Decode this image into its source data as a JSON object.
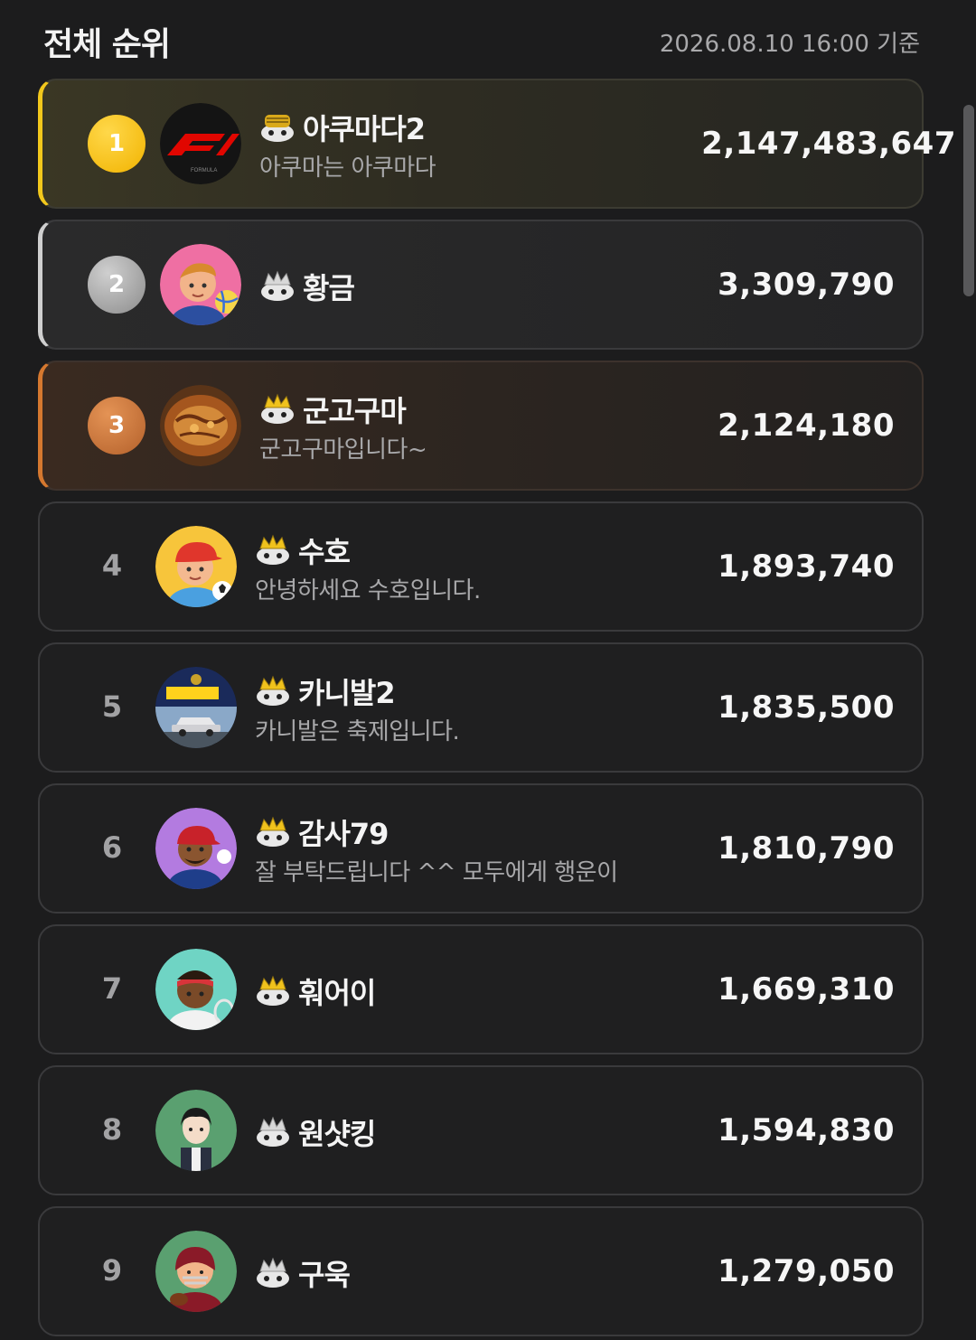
{
  "header": {
    "title": "전체 순위",
    "timestamp": "2026.08.10 16:00 기준"
  },
  "ranking": [
    {
      "rank": "1",
      "name": "아쿠마다2",
      "bio": "아쿠마는 아쿠마다",
      "score": "2,147,483,647",
      "avatar": "f1-logo-avatar",
      "level": "gold-level-icon"
    },
    {
      "rank": "2",
      "name": "황금",
      "bio": "",
      "score": "3,309,790",
      "avatar": "volleyball-boy-avatar",
      "level": "silver-level-icon"
    },
    {
      "rank": "3",
      "name": "군고구마",
      "bio": "군고구마입니다~",
      "score": "2,124,180",
      "avatar": "roasted-sweet-potato-avatar",
      "level": "gold-level-icon"
    },
    {
      "rank": "4",
      "name": "수호",
      "bio": "안녕하세요 수호입니다.",
      "score": "1,893,740",
      "avatar": "soccer-boy-avatar",
      "level": "gold-level-icon"
    },
    {
      "rank": "5",
      "name": "카니발2",
      "bio": "카니발은 축제입니다.",
      "score": "1,835,500",
      "avatar": "carnival-car-avatar",
      "level": "gold-level-icon"
    },
    {
      "rank": "6",
      "name": "감사79",
      "bio": "잘 부탁드립니다 ^^ 모두에게 행운이",
      "score": "1,810,790",
      "avatar": "baseball-man-avatar",
      "level": "gold-level-icon"
    },
    {
      "rank": "7",
      "name": "훠어이",
      "bio": "",
      "score": "1,669,310",
      "avatar": "tennis-player-avatar",
      "level": "gold-level-icon"
    },
    {
      "rank": "8",
      "name": "원샷킹",
      "bio": "",
      "score": "1,594,830",
      "avatar": "cartoon-man-avatar",
      "level": "silver-level-icon"
    },
    {
      "rank": "9",
      "name": "구욱",
      "bio": "",
      "score": "1,279,050",
      "avatar": "football-player-avatar",
      "level": "silver-level-icon"
    }
  ],
  "colors": {
    "background": "#1c1c1d",
    "gold": "#f2c81c",
    "silver": "#cfcfcf",
    "bronze": "#d5782f"
  }
}
